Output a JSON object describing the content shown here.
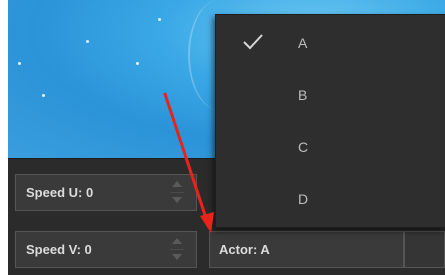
{
  "controls": {
    "speed_u_label": "Speed U: 0",
    "speed_v_label": "Speed V: 0",
    "actor_label": "Actor: A"
  },
  "dropdown": {
    "selected": "A",
    "options": [
      "A",
      "B",
      "C",
      "D"
    ]
  },
  "icons": {
    "check": "check-icon",
    "spinner_up": "chevron-up-icon",
    "spinner_down": "chevron-down-icon",
    "annotation": "red-arrow-annotation"
  },
  "colors": {
    "panel_bg": "#2b2b2b",
    "field_bg": "#3a3a3a",
    "menu_bg": "#2e2e2e",
    "text": "#dcdcdc",
    "menu_text": "#bdbdbd",
    "annotation_arrow": "#e8231c",
    "viewport_blue": "#2b93d8"
  }
}
